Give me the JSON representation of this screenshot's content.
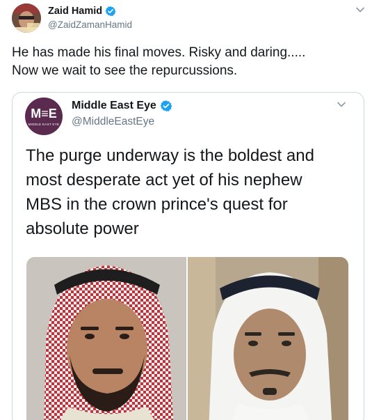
{
  "tweet": {
    "display_name": "Zaid Hamid",
    "handle": "@ZaidZamanHamid",
    "text_line1": "He has made his final moves. Risky and daring.....",
    "text_line2": "Now we wait to see the repurcussions.",
    "icons": {
      "verified": "verified-badge-icon",
      "menu": "chevron-down-icon"
    }
  },
  "quoted_tweet": {
    "display_name": "Middle East Eye",
    "handle": "@MiddleEastEye",
    "logo_mark": "M≡E",
    "logo_sub": "MIDDLE EAST EYE",
    "text_line1": "The purge underway is the boldest and",
    "text_line2": "most desperate act yet of his nephew",
    "text_line3": "MBS in the crown prince's quest for",
    "text_line4": "absolute power",
    "media": "photo-two-men-in-traditional-headdress"
  },
  "colors": {
    "verified": "#1da1f2",
    "text": "#14171a",
    "secondary": "#657786",
    "border": "#ccd6dd",
    "mee_brand": "#5a2a4f"
  }
}
